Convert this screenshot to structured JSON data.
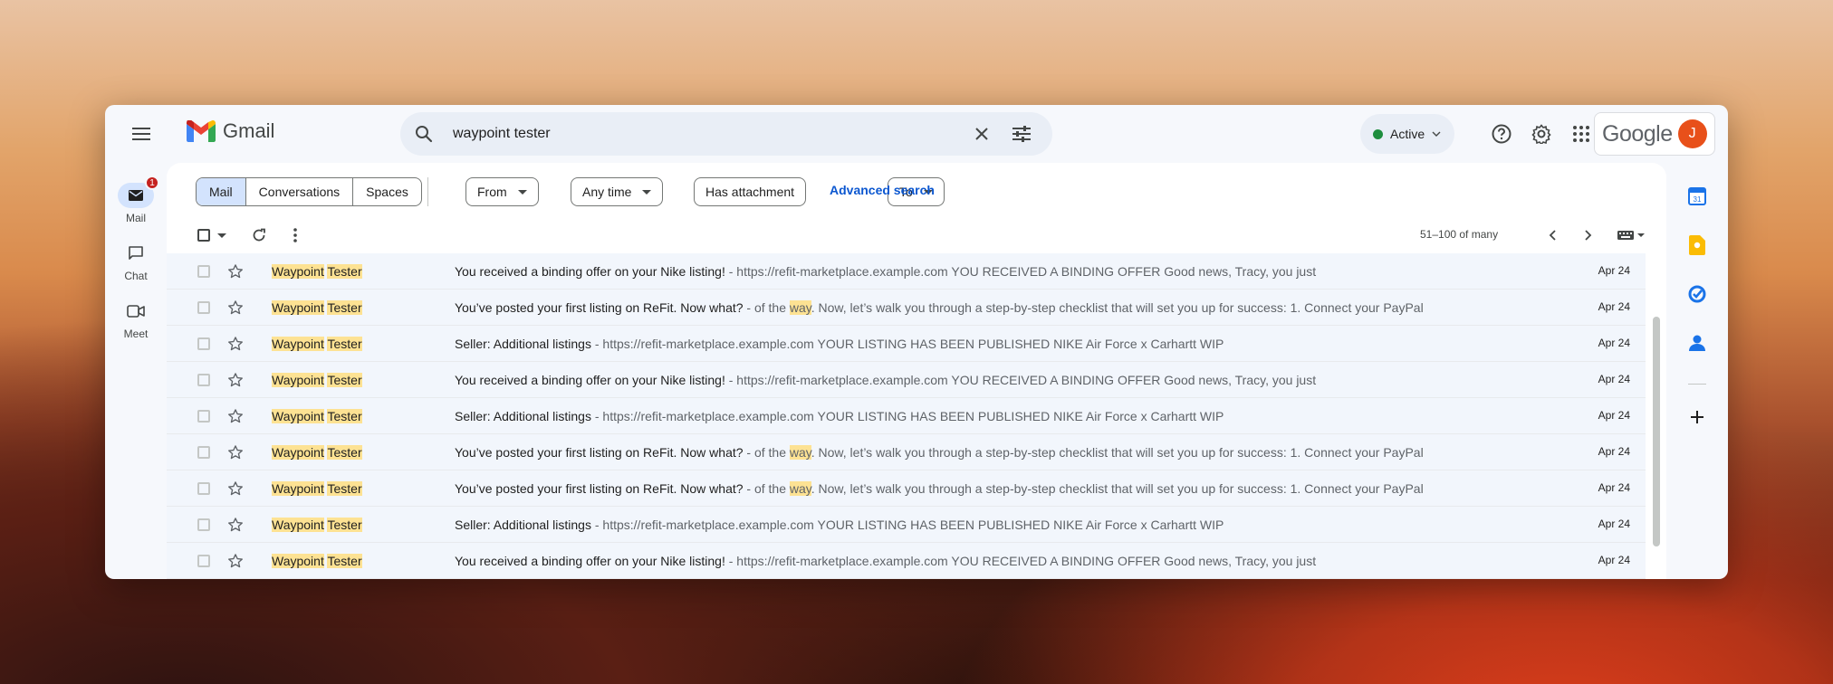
{
  "header": {
    "app_name": "Gmail",
    "search_value": "waypoint tester",
    "status_label": "Active",
    "google_label": "Google",
    "avatar_initial": "J"
  },
  "rail": {
    "items": [
      {
        "label": "Mail",
        "badge": "1"
      },
      {
        "label": "Chat"
      },
      {
        "label": "Meet"
      }
    ]
  },
  "filters": {
    "segments": [
      "Mail",
      "Conversations",
      "Spaces"
    ],
    "chips": [
      "From",
      "Any time",
      "Has attachment",
      "To"
    ],
    "advanced": "Advanced search"
  },
  "toolbar": {
    "pagination": "51–100 of many"
  },
  "emails": [
    {
      "sender_a": "Waypoint",
      "sender_b": "Tester",
      "subject": "You received a binding offer on your Nike listing!",
      "snippet_pre": " - https://refit-marketplace.example.com YOU RECEIVED A BINDING OFFER Good news, Tracy, you just",
      "snippet_hl": "",
      "snippet_post": "",
      "date": "Apr 24"
    },
    {
      "sender_a": "Waypoint",
      "sender_b": "Tester",
      "subject": "You’ve posted your first listing on ReFit. Now what?",
      "snippet_pre": " - of the ",
      "snippet_hl": "way",
      "snippet_post": ". Now, let’s walk you through a step-by-step checklist that will set you up for success: 1. Connect your PayPal",
      "date": "Apr 24"
    },
    {
      "sender_a": "Waypoint",
      "sender_b": "Tester",
      "subject": "Seller: Additional listings",
      "snippet_pre": " - https://refit-marketplace.example.com YOUR LISTING HAS BEEN PUBLISHED NIKE Air Force x Carhartt WIP",
      "snippet_hl": "",
      "snippet_post": "",
      "date": "Apr 24"
    },
    {
      "sender_a": "Waypoint",
      "sender_b": "Tester",
      "subject": "You received a binding offer on your Nike listing!",
      "snippet_pre": " - https://refit-marketplace.example.com YOU RECEIVED A BINDING OFFER Good news, Tracy, you just",
      "snippet_hl": "",
      "snippet_post": "",
      "date": "Apr 24"
    },
    {
      "sender_a": "Waypoint",
      "sender_b": "Tester",
      "subject": "Seller: Additional listings",
      "snippet_pre": " - https://refit-marketplace.example.com YOUR LISTING HAS BEEN PUBLISHED NIKE Air Force x Carhartt WIP",
      "snippet_hl": "",
      "snippet_post": "",
      "date": "Apr 24"
    },
    {
      "sender_a": "Waypoint",
      "sender_b": "Tester",
      "subject": "You’ve posted your first listing on ReFit. Now what?",
      "snippet_pre": " - of the ",
      "snippet_hl": "way",
      "snippet_post": ". Now, let’s walk you through a step-by-step checklist that will set you up for success: 1. Connect your PayPal",
      "date": "Apr 24"
    },
    {
      "sender_a": "Waypoint",
      "sender_b": "Tester",
      "subject": "You’ve posted your first listing on ReFit. Now what?",
      "snippet_pre": " - of the ",
      "snippet_hl": "way",
      "snippet_post": ". Now, let’s walk you through a step-by-step checklist that will set you up for success: 1. Connect your PayPal",
      "date": "Apr 24"
    },
    {
      "sender_a": "Waypoint",
      "sender_b": "Tester",
      "subject": "Seller: Additional listings",
      "snippet_pre": " - https://refit-marketplace.example.com YOUR LISTING HAS BEEN PUBLISHED NIKE Air Force x Carhartt WIP",
      "snippet_hl": "",
      "snippet_post": "",
      "date": "Apr 24"
    },
    {
      "sender_a": "Waypoint",
      "sender_b": "Tester",
      "subject": "You received a binding offer on your Nike listing!",
      "snippet_pre": " - https://refit-marketplace.example.com YOU RECEIVED A BINDING OFFER Good news, Tracy, you just",
      "snippet_hl": "",
      "snippet_post": "",
      "date": "Apr 24"
    }
  ],
  "colors": {
    "accent": "#0b57d0",
    "highlight": "#fde293",
    "avatar": "#e8501a",
    "active_status": "#1e8e3e"
  }
}
